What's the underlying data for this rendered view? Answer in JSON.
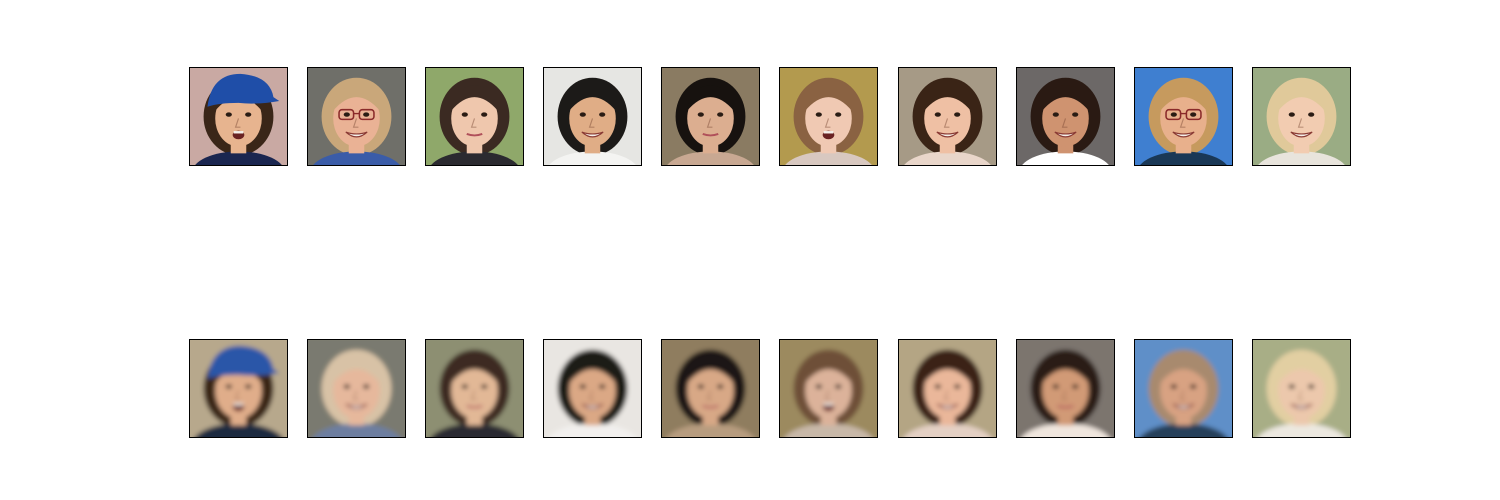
{
  "figure": {
    "rows": [
      {
        "kind": "original",
        "blur": 0,
        "faces": [
          {
            "bg": "#c9a9a3",
            "skin": "#e7b48f",
            "hair": "#3a2618",
            "hat": "#1f4ea8",
            "shirt": "#1a2650",
            "glasses": false,
            "mouth": "open"
          },
          {
            "bg": "#6f6f69",
            "skin": "#eab295",
            "hair": "#c9a77a",
            "hat": null,
            "shirt": "#3a5ca8",
            "glasses": true,
            "mouth": "smile"
          },
          {
            "bg": "#8fa86a",
            "skin": "#efc7ad",
            "hair": "#3b2a22",
            "hat": null,
            "shirt": "#2b2a30",
            "glasses": false,
            "mouth": "closed"
          },
          {
            "bg": "#e6e6e3",
            "skin": "#e0ad86",
            "hair": "#1c1a18",
            "hat": null,
            "shirt": "#f4f4f2",
            "glasses": false,
            "mouth": "smile"
          },
          {
            "bg": "#8a7b62",
            "skin": "#dcae90",
            "hair": "#17120f",
            "hat": null,
            "shirt": "#c8a892",
            "glasses": false,
            "mouth": "closed"
          },
          {
            "bg": "#b39a4e",
            "skin": "#f0c9b3",
            "hair": "#8a6242",
            "hat": null,
            "shirt": "#d8c8c0",
            "glasses": false,
            "mouth": "open"
          },
          {
            "bg": "#a69a86",
            "skin": "#efc0a4",
            "hair": "#3a2416",
            "hat": null,
            "shirt": "#e9d6ca",
            "glasses": false,
            "mouth": "smile"
          },
          {
            "bg": "#6c6867",
            "skin": "#cf9370",
            "hair": "#2a1a13",
            "hat": null,
            "shirt": "#ffffff",
            "glasses": false,
            "mouth": "smile"
          },
          {
            "bg": "#3f7fd0",
            "skin": "#e8b08c",
            "hair": "#c69a5e",
            "hat": null,
            "shirt": "#1a3856",
            "glasses": true,
            "mouth": "smile"
          },
          {
            "bg": "#9aac84",
            "skin": "#f2ccb1",
            "hair": "#e0c99a",
            "hat": null,
            "shirt": "#e8e4dc",
            "glasses": false,
            "mouth": "smile"
          }
        ]
      },
      {
        "kind": "reconstructed",
        "blur": 2.6,
        "faces": [
          {
            "bg": "#b7a88c",
            "skin": "#e0ad8a",
            "hair": "#3a2618",
            "hat": "#2a56a8",
            "shirt": "#1e2a40",
            "glasses": false,
            "mouth": "open"
          },
          {
            "bg": "#7a7a70",
            "skin": "#e6b89c",
            "hair": "#d8c2a6",
            "hat": null,
            "shirt": "#6d7ea0",
            "glasses": false,
            "mouth": "smile"
          },
          {
            "bg": "#8d8f72",
            "skin": "#e2b896",
            "hair": "#3e2c22",
            "hat": null,
            "shirt": "#2b2a30",
            "glasses": false,
            "mouth": "closed"
          },
          {
            "bg": "#e9e6e2",
            "skin": "#dba885",
            "hair": "#1c1a18",
            "hat": null,
            "shirt": "#f2f0ee",
            "glasses": false,
            "mouth": "smile"
          },
          {
            "bg": "#8f7d5e",
            "skin": "#d8a886",
            "hair": "#1d1712",
            "hat": null,
            "shirt": "#b79c7f",
            "glasses": false,
            "mouth": "closed"
          },
          {
            "bg": "#9c8a5e",
            "skin": "#dcb29a",
            "hair": "#6e5038",
            "hat": null,
            "shirt": "#c8b8a8",
            "glasses": false,
            "mouth": "open"
          },
          {
            "bg": "#b4a584",
            "skin": "#eab79a",
            "hair": "#3a2416",
            "hat": null,
            "shirt": "#e4d0c4",
            "glasses": false,
            "mouth": "smile"
          },
          {
            "bg": "#7b756e",
            "skin": "#d19a76",
            "hair": "#2a1a13",
            "hat": null,
            "shirt": "#f0e6de",
            "glasses": false,
            "mouth": "closed"
          },
          {
            "bg": "#5f8fc8",
            "skin": "#d8a282",
            "hair": "#a88a6e",
            "hat": null,
            "shirt": "#26405a",
            "glasses": false,
            "mouth": "smile"
          },
          {
            "bg": "#a8ae86",
            "skin": "#ecc8ac",
            "hair": "#e2cfa2",
            "hat": null,
            "shirt": "#ece8e0",
            "glasses": false,
            "mouth": "smile"
          }
        ]
      }
    ]
  }
}
